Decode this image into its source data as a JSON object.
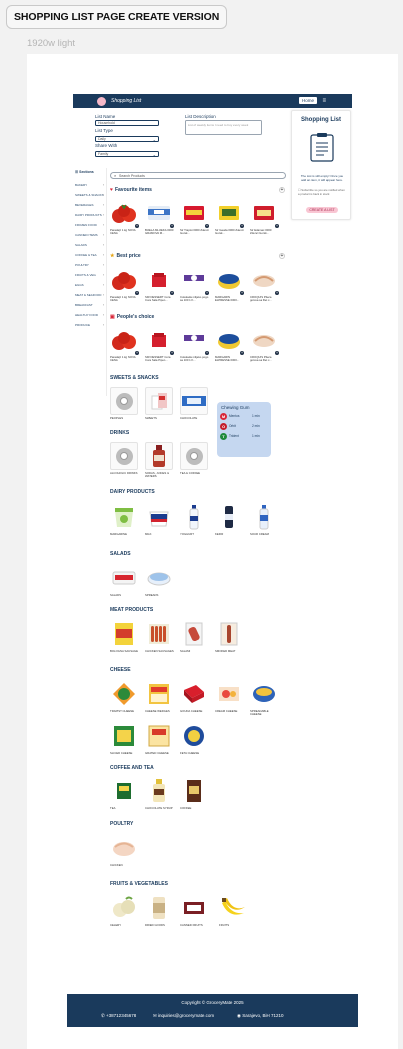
{
  "header_label": "SHOPPING LIST PAGE CREATE VERSION",
  "frame_label": "1920w light",
  "topbar": {
    "app_title": "Shopping List",
    "home_label": "Home"
  },
  "form": {
    "list_name_label": "List Name",
    "list_name_value": "Household",
    "list_type_label": "List Type",
    "list_type_value": "Daily",
    "share_with_label": "Share With",
    "share_with_value": "Family",
    "description_label": "List Description",
    "description_placeholder": "List of weekly items I need to buy every week"
  },
  "right_panel": {
    "title": "Shopping List",
    "empty_text": "The List is still empty! Once you add an item, it will appear here.",
    "checkbox_text": "Subscribe so you are notified when a product is back in stock",
    "create_button": "CREATE A LIST"
  },
  "sidebar": {
    "title": "Sections",
    "items": [
      "BAKERY",
      "SWEETS & SNACKS",
      "BEVERAGES",
      "DAIRY PRODUCTS",
      "FROZEN FOOD",
      "CANNED ITEMS",
      "SALADS",
      "COFFEE & TEA",
      "POULTRY",
      "FRUITS & VEG",
      "EGGS",
      "MEAT & SEAFOOD",
      "BREAKFAST",
      "HEALTHY FOOD",
      "PRODUCE"
    ]
  },
  "search": {
    "placeholder": "Search Products"
  },
  "sections": {
    "favourites": "Favourite items",
    "best_price": "Best price",
    "peoples_choice": "People's choice",
    "sweets": "SWEETS & SNACKS",
    "drinks": "DRINKS",
    "dairy": "DAIRY PRODUCTS",
    "salads": "SALADS",
    "meat": "MEAT PRODUCTS",
    "cheese": "CHEESE",
    "coffee": "COFFEE AND TEA",
    "poultry": "POULTRY",
    "fruits": "FRUITS & VEGETABLES"
  },
  "favourites": [
    "Paradajz 1 kg NOVA CENA",
    "BIJELA MLIJEKA 0000 GRAMOVA M...",
    "Sir Trapist 0000 Zdenci Gorsk...",
    "Sir Gauda 0000 Zdenci Gorsk...",
    "Sir Edamac 0000 Zdenci Gorsk..."
  ],
  "best_price": [
    "Paradajz 1 kg NOVA CENA",
    "SIR DESSERT Cora Cora Sala Pipen...",
    "Cokolada mlijeko pogo sa 100 1 K...",
    "MARGARIN ELPRESSE 0000...",
    "CROQUIS Pileca gotova sa filet c..."
  ],
  "peoples_choice": [
    "Paradajz 1 kg NOVA CENA",
    "SIR DESSERT Cora Cora Sala Pipen...",
    "Cokolada mlijeko pogo sa 100 1 K...",
    "MARGARIN ELPRESSE 0000...",
    "CROQUIS Pileca gotova sa filet c..."
  ],
  "sweets_items": [
    "PEOPLES",
    "SWEETS",
    "CHOCOLATE"
  ],
  "drinks_items": [
    "ALCOHOLIC DRINKS",
    "SODAS, JUICES & WATERS",
    "TEA & COFFEE"
  ],
  "dairy_items": [
    "MARGARINE",
    "MILK",
    "YOGHURT",
    "KEFIR",
    "SOUR CREAM"
  ],
  "salad_items": [
    "SALADS",
    "SPREADS"
  ],
  "meat_items": [
    "BOLOGNA SAUSAGE",
    "CHICKEN SAUSAGES",
    "SALAMI",
    "SMOKED MEAT"
  ],
  "cheese_items": [
    "TRAPIST CHEESE",
    "CHEESE WEDGES",
    "GOUDA CHEESE",
    "CREAM CHEESE",
    "SPREADABLE CHEESE",
    "SLICED CHEESE",
    "GRATED CHEESE",
    "FETA CHEESE"
  ],
  "coffee_items": [
    "TEA",
    "CHOCOLATE SYRUP",
    "COFFEE"
  ],
  "poultry_items": [
    "CHICKEN"
  ],
  "fruits_items": [
    "CELERY",
    "DRIED GOODS",
    "CANNED FRUITS",
    "FRUITS"
  ],
  "popup": {
    "title": "Chewing Gum",
    "rows": [
      {
        "name": "Mentos",
        "time": "1 min"
      },
      {
        "name": "Orbit",
        "time": "2 min"
      },
      {
        "name": "Trident",
        "time": "1 min"
      }
    ]
  },
  "footer": {
    "copyright": "Copyright © GroceryMate 2025",
    "phone": "+38712345678",
    "email": "inquiries@grocerymate.com",
    "address": "Sarajevo, BiH 71210"
  },
  "colors": {
    "navy": "#1a3a5c",
    "accent_pink": "#f9c6d3",
    "popup_blue": "#c5d7f0"
  }
}
